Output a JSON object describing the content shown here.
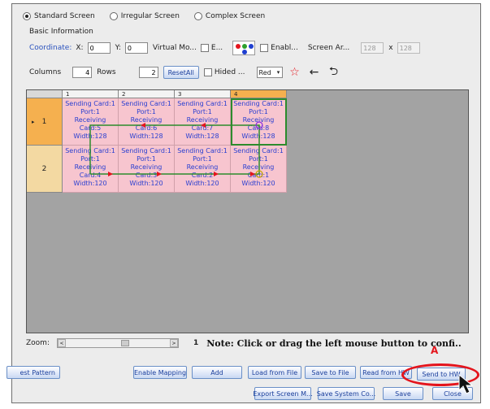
{
  "modes": [
    {
      "label": "Standard Screen",
      "selected": true
    },
    {
      "label": "Irregular Screen",
      "selected": false
    },
    {
      "label": "Complex Screen",
      "selected": false
    }
  ],
  "basic_info": {
    "title": "Basic Information",
    "coordinate_label": "Coordinate:",
    "x_label": "X:",
    "x_value": "0",
    "y_label": "Y:",
    "y_value": "0",
    "virtual_mode_label": "Virtual Mo...",
    "e_label": "E...",
    "enable_label": "Enabl...",
    "screen_area_label": "Screen Ar...",
    "screen_w": "128",
    "x_sep": "x",
    "screen_h": "128"
  },
  "layout": {
    "columns_label": "Columns",
    "columns_value": "4",
    "rows_label": "Rows",
    "rows_value": "2",
    "reset_all_label": "ResetAll",
    "hidden_label": "Hided ...",
    "color_value": "Red",
    "color_caret": "▾",
    "star_icon": "☆",
    "back_icon": "←",
    "undo_icon": "⮌"
  },
  "grid": {
    "col_headers": [
      "1",
      "2",
      "3",
      "4"
    ],
    "row_headers": [
      "1",
      "2"
    ],
    "selected_row": 0,
    "selected_marker": "▸",
    "cells": [
      [
        {
          "lines": [
            "Sending Card:1",
            "Port:1",
            "Receiving",
            "Card:5",
            "Width:128"
          ]
        },
        {
          "lines": [
            "Sending Card:1",
            "Port:1",
            "Receiving",
            "Card:6",
            "Width:128"
          ]
        },
        {
          "lines": [
            "Sending Card:1",
            "Port:1",
            "Receiving",
            "Card:7",
            "Width:128"
          ]
        },
        {
          "lines": [
            "Sending Card:1",
            "Port:1",
            "Receiving",
            "Card:8",
            "Width:128"
          ]
        }
      ],
      [
        {
          "lines": [
            "Sending Card:1",
            "Port:1",
            "Receiving",
            "Card:4",
            "Width:120"
          ]
        },
        {
          "lines": [
            "Sending Card:1",
            "Port:1",
            "Receiving",
            "Card:3",
            "Width:120"
          ]
        },
        {
          "lines": [
            "Sending Card:1",
            "Port:1",
            "Receiving",
            "Card:2",
            "Width:120"
          ]
        },
        {
          "lines": [
            "Sending Card:1",
            "Port:1",
            "Receiving",
            "Card:1",
            "Width:120"
          ]
        }
      ]
    ]
  },
  "zoom": {
    "label": "Zoom:",
    "left_arrow": "<",
    "right_arrow": ">",
    "value": "1"
  },
  "note": "Note: Click or drag the left mouse button to confi..",
  "buttons_row1": [
    "est Pattern",
    "Enable Mapping",
    "Add",
    "Load from File",
    "Save to File",
    "Read from HW",
    "Send to HW"
  ],
  "buttons_row2": [
    "Export Screen M...",
    "Save System Co...",
    "Save",
    "Close"
  ],
  "annotation_label": "A",
  "colors": {
    "accent": "#2a52be",
    "cell_bg": "#f7c5cf",
    "highlight": "#e4141c",
    "selected_header": "#f5b04f"
  }
}
